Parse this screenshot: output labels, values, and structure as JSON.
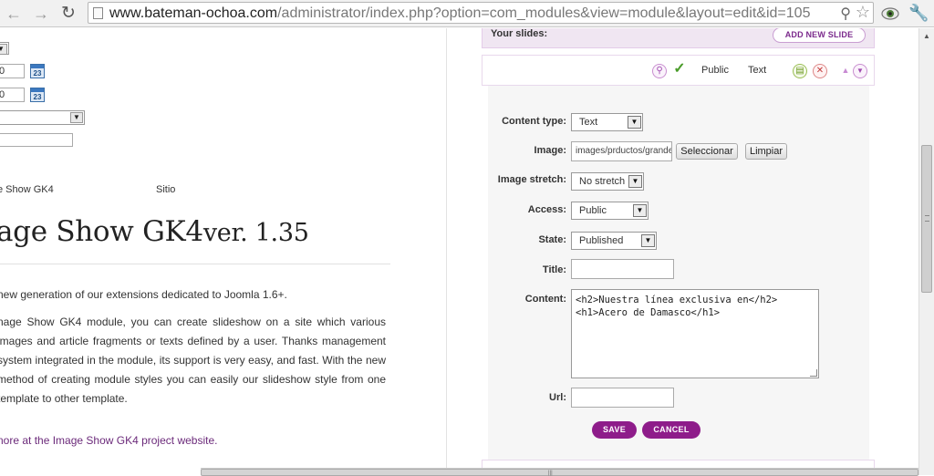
{
  "browser": {
    "url_domain": "www.bateman-ochoa.com",
    "url_path": "/administrator/index.php?option=com_modules&view=module&layout=edit&id=105"
  },
  "left_pane": {
    "date_field_1": "0",
    "date_field_2": "0",
    "calendar_day": "23",
    "meta_module": "e Show GK4",
    "meta_site": "Sitio",
    "heading": "age Show GK4",
    "heading_version": "ver. 1.35",
    "paragraph_1": "new generation of our extensions dedicated to Joomla 1.6+.",
    "paragraph_2": "nage Show GK4 module, you can create slideshow on a site which various images and article fragments or texts defined by a user. Thanks management system integrated in the module, its support is very easy, and fast. With the new method of creating module styles you can easily our slideshow style from one template to other template.",
    "more_link": "nore at the Image Show GK4 project website."
  },
  "right_pane": {
    "slides_label": "Your slides:",
    "add_new_slide": "ADD NEW SLIDE",
    "slide_header": {
      "access": "Public",
      "type": "Text"
    },
    "form": {
      "content_type_label": "Content type:",
      "content_type_value": "Text",
      "image_label": "Image:",
      "image_value": "images/prductos/grande",
      "select_button": "Seleccionar",
      "clear_button": "Limpiar",
      "image_stretch_label": "Image stretch:",
      "image_stretch_value": "No stretch",
      "access_label": "Access:",
      "access_value": "Public",
      "state_label": "State:",
      "state_value": "Published",
      "title_label": "Title:",
      "title_value": "",
      "content_label": "Content:",
      "content_value": "<h2>Nuestra línea exclusiva en</h2>\n<h1>Acero de Damasco</h1>",
      "url_label": "Url:",
      "url_value": "",
      "save_button": "SAVE",
      "cancel_button": "CANCEL"
    }
  },
  "colors": {
    "accent": "#8e1c8a",
    "accent_light": "#f0e6f2",
    "link": "#6b2a7a"
  }
}
